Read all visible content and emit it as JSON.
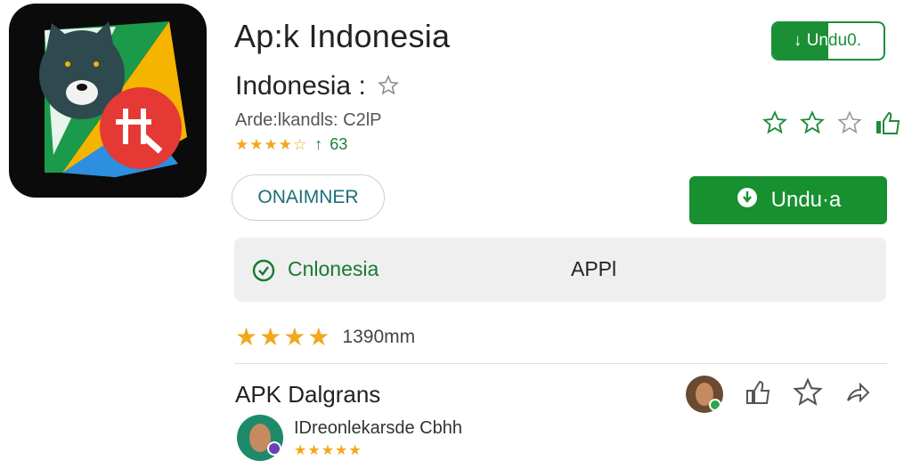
{
  "app": {
    "title": "Ap:k Indonesia",
    "subtitle": "Indonesia :",
    "developer": "Ardе:lkandls: C2lP",
    "rating_stars": "★★★★☆",
    "rating_value": "63",
    "rating_arrow": "↑"
  },
  "top_download": {
    "label_part1": "↓ Un",
    "label_part2": "du0."
  },
  "outline_button": {
    "label": "ONAIMNER"
  },
  "download_button": {
    "label": "Undu·a"
  },
  "info_box": {
    "label": "Cnlonesia",
    "right_text": "APPl"
  },
  "reviews_summary": {
    "stars": "★★★★",
    "count": "1390mm"
  },
  "section": {
    "title": "APK Dalgrans"
  },
  "review": {
    "name": "IDreonlekarsde   Cbhh",
    "stars": "★★★★★"
  },
  "icons": {
    "app": "bear-and-badge-app-icon",
    "subtitle_star": "star-outline-icon",
    "rate": [
      "star-outline-icon",
      "star-outline-icon",
      "star-outline-icon",
      "thumbs-up-icon"
    ],
    "section": [
      "avatar",
      "thumbs-up-icon",
      "star-outline-icon",
      "share-icon"
    ]
  },
  "colors": {
    "accent": "#17902f",
    "star": "#f2a81d",
    "teal_text": "#1a6f79"
  }
}
